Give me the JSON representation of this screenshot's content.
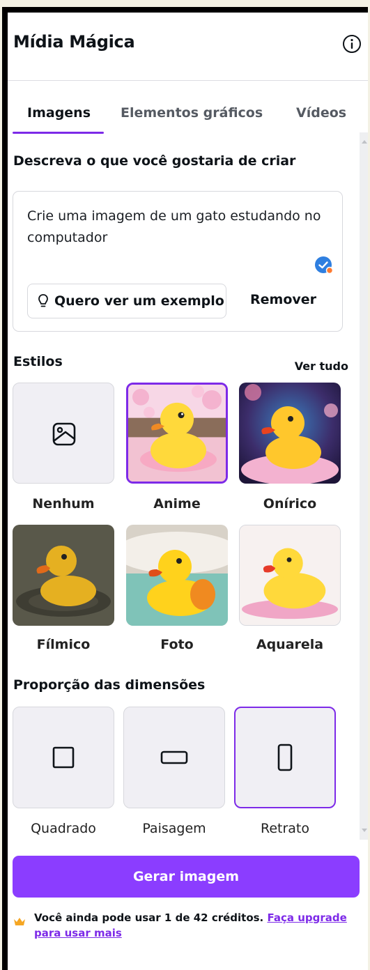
{
  "app": {
    "title": "Mídia Mágica",
    "info_icon": "info-icon"
  },
  "tabs": [
    {
      "label": "Imagens",
      "active": true
    },
    {
      "label": "Elementos gráficos",
      "active": false
    },
    {
      "label": "Vídeos",
      "active": false
    }
  ],
  "prompt": {
    "heading": "Descreva o que você gostaria de criar",
    "text": "Crie uma imagem de um gato estudando no computador",
    "example_button": "Quero ver um exemplo",
    "remove_button": "Remover"
  },
  "styles": {
    "heading": "Estilos",
    "see_all": "Ver tudo",
    "items": [
      {
        "label": "Nenhum",
        "selected": false
      },
      {
        "label": "Anime",
        "selected": true
      },
      {
        "label": "Onírico",
        "selected": false
      },
      {
        "label": "Fílmico",
        "selected": false
      },
      {
        "label": "Foto",
        "selected": false
      },
      {
        "label": "Aquarela",
        "selected": false
      }
    ]
  },
  "ratio": {
    "heading": "Proporção das dimensões",
    "items": [
      {
        "label": "Quadrado",
        "selected": false
      },
      {
        "label": "Paisagem",
        "selected": false
      },
      {
        "label": "Retrato",
        "selected": true
      }
    ]
  },
  "generate_button": "Gerar imagem",
  "credits": {
    "text": "Você ainda pode usar 1 de 42 créditos.",
    "link": "Faça upgrade para usar mais"
  },
  "colors": {
    "accent": "#8b3dff",
    "selected_border": "#7d2ae8"
  }
}
